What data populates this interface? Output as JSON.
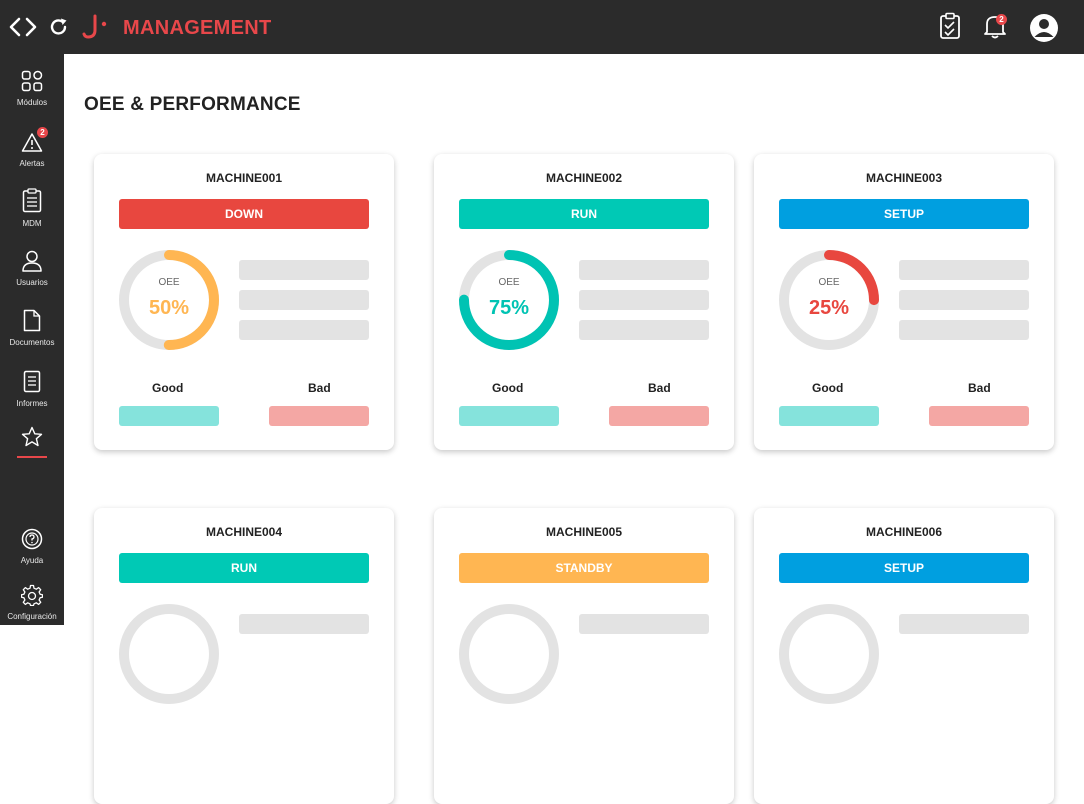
{
  "app": {
    "title": "MANAGEMENT",
    "notifications_count": "2"
  },
  "sidebar": {
    "items": [
      {
        "label": "Módulos",
        "icon": "grid-icon"
      },
      {
        "label": "Alertas",
        "icon": "alert-triangle-icon",
        "badge": "2"
      },
      {
        "label": "MDM",
        "icon": "clipboard-list-icon"
      },
      {
        "label": "Usuarios",
        "icon": "user-icon"
      },
      {
        "label": "Documentos",
        "icon": "document-icon"
      },
      {
        "label": "Informes",
        "icon": "report-icon"
      },
      {
        "label": "",
        "icon": "star-icon"
      },
      {
        "label": "Ayuda",
        "icon": "help-icon"
      },
      {
        "label": "Configuración",
        "icon": "gear-icon"
      }
    ]
  },
  "page": {
    "title": "OEE & PERFORMANCE"
  },
  "labels": {
    "oee": "OEE",
    "good": "Good",
    "bad": "Bad"
  },
  "colors": {
    "down": "#e8473f",
    "run": "#00c9b5",
    "setup": "#009fe0",
    "standby": "#ffb652",
    "oee_50": "#ffb652",
    "oee_75": "#00c3b3",
    "oee_25": "#e8473f",
    "gauge_track": "#e3e3e3"
  },
  "machines": [
    {
      "name": "MACHINE001",
      "status": "DOWN",
      "oee": "50%",
      "oee_fraction": 0.5
    },
    {
      "name": "MACHINE002",
      "status": "RUN",
      "oee": "75%",
      "oee_fraction": 0.75
    },
    {
      "name": "MACHINE003",
      "status": "SETUP",
      "oee": "25%",
      "oee_fraction": 0.25
    },
    {
      "name": "MACHINE004",
      "status": "RUN"
    },
    {
      "name": "MACHINE005",
      "status": "STANDBY"
    },
    {
      "name": "MACHINE006",
      "status": "SETUP"
    }
  ]
}
